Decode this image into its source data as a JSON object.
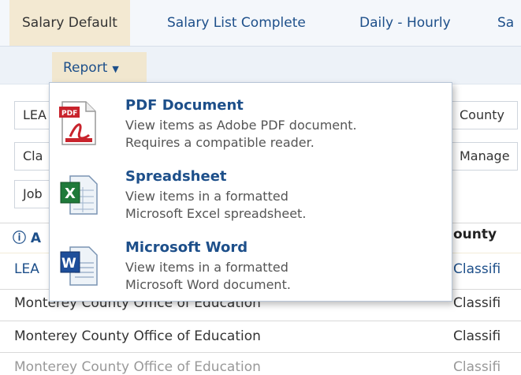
{
  "tabs": [
    {
      "label": "Salary Default"
    },
    {
      "label": "Salary List Complete"
    },
    {
      "label": "Daily - Hourly"
    },
    {
      "label": "Sa"
    }
  ],
  "toolbar": {
    "report_label": "Report"
  },
  "fields": [
    {
      "left": "LEA",
      "right": "County"
    },
    {
      "left": "Cla",
      "right": "Manage"
    },
    {
      "left": "Job",
      "right": ""
    }
  ],
  "section": {
    "left": "A",
    "right": "ounty"
  },
  "rows": [
    {
      "left": "LEA",
      "right": "Classifi"
    },
    {
      "left": "Monterey County Office of Education",
      "right": "Classifi"
    },
    {
      "left": "Monterey County Office of Education",
      "right": "Classifi"
    },
    {
      "left": "Monterey County Office of Education",
      "right": "Classifi"
    }
  ],
  "menu": {
    "items": [
      {
        "title": "PDF Document",
        "line1": "View items as Adobe PDF document.",
        "line2": "Requires a compatible reader.",
        "icon": "pdf-icon"
      },
      {
        "title": "Spreadsheet",
        "line1": "View items in a formatted",
        "line2": "Microsoft Excel spreadsheet.",
        "icon": "excel-icon"
      },
      {
        "title": "Microsoft Word",
        "line1": "View items in a formatted",
        "line2": "Microsoft Word document.",
        "icon": "word-icon"
      }
    ]
  }
}
